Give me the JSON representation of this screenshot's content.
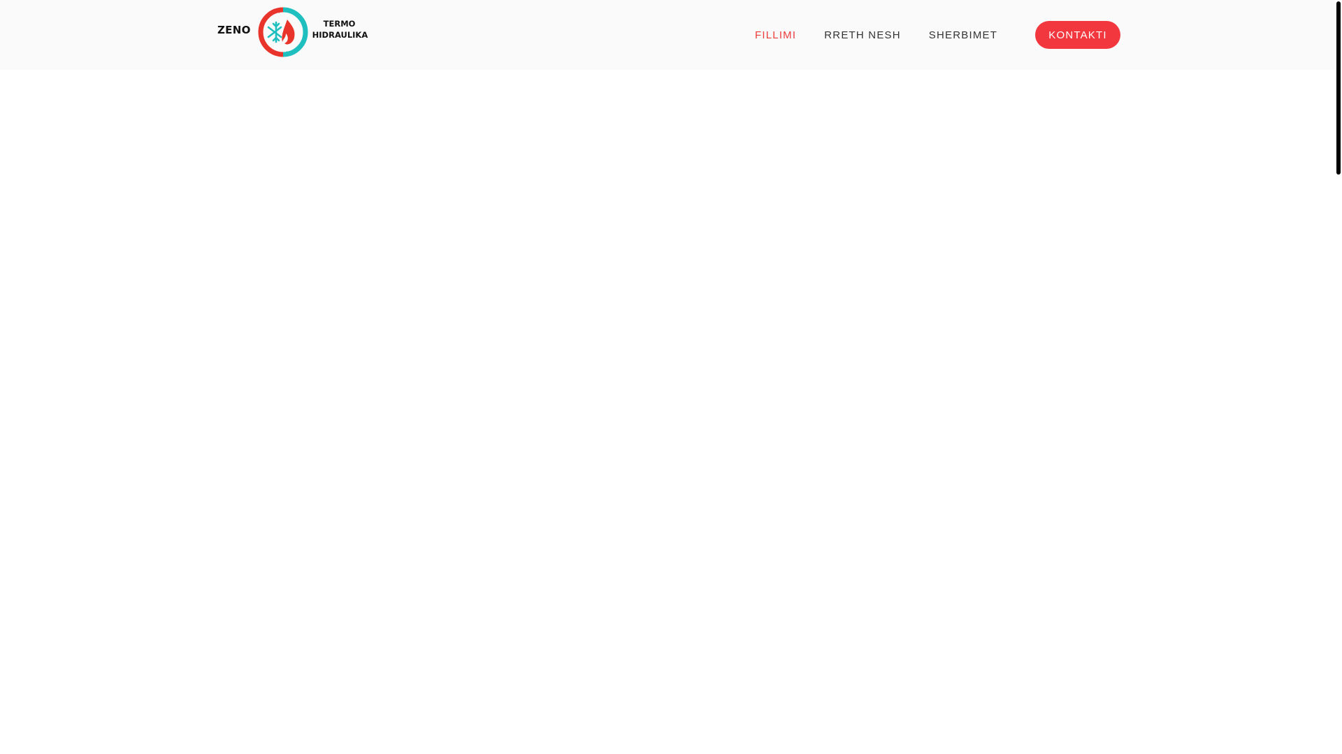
{
  "brand": {
    "name_left": "ZENO",
    "name_right_line1": "TERMO",
    "name_right_line2": "HIDRAULIKA",
    "mark_icon": "flame-snowflake-circle-icon",
    "colors": {
      "red": "#e8342b",
      "teal": "#1fbfbf"
    }
  },
  "nav": {
    "items": [
      {
        "label": "FILLIMI",
        "active": true
      },
      {
        "label": "RRETH NESH",
        "active": false
      },
      {
        "label": "SHERBIMET",
        "active": false
      }
    ],
    "cta_label": "KONTAKTI",
    "active_color": "#ed3b3b",
    "cta_color": "#f2373e"
  }
}
